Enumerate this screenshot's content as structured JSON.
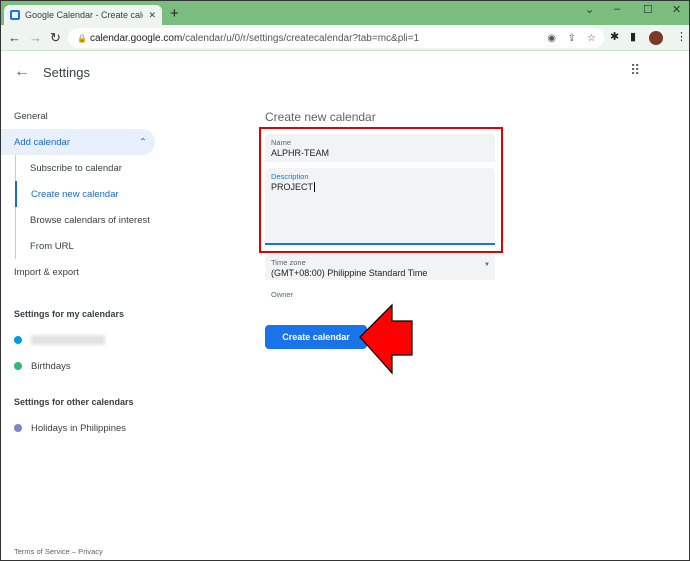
{
  "browser": {
    "tab_title": "Google Calendar - Create calendar",
    "url_host": "calendar.google.com",
    "url_path": "/calendar/u/0/r/settings/createcalendar?tab=mc&pli=1"
  },
  "header": {
    "title": "Settings"
  },
  "sidebar": {
    "items": [
      {
        "label": "General"
      },
      {
        "label": "Add calendar"
      },
      {
        "label": "Subscribe to calendar"
      },
      {
        "label": "Create new calendar"
      },
      {
        "label": "Browse calendars of interest"
      },
      {
        "label": "From URL"
      },
      {
        "label": "Import & export"
      }
    ],
    "my_calendars_heading": "Settings for my calendars",
    "my_calendars": [
      {
        "label": "",
        "color": "#039be5"
      },
      {
        "label": "Birthdays",
        "color": "#33b679"
      }
    ],
    "other_calendars_heading": "Settings for other calendars",
    "other_calendars": [
      {
        "label": "Holidays in Philippines",
        "color": "#7986cb"
      }
    ],
    "footer": "Terms of Service – Privacy"
  },
  "form": {
    "title": "Create new calendar",
    "name_label": "Name",
    "name_value": "ALPHR-TEAM",
    "description_label": "Description",
    "description_value": "PROJECT",
    "timezone_label": "Time zone",
    "timezone_value": "(GMT+08:00) Philippine Standard Time",
    "owner_label": "Owner",
    "create_button": "Create calendar"
  },
  "colors": {
    "accent": "#1a73e8",
    "highlight": "#e00000"
  }
}
